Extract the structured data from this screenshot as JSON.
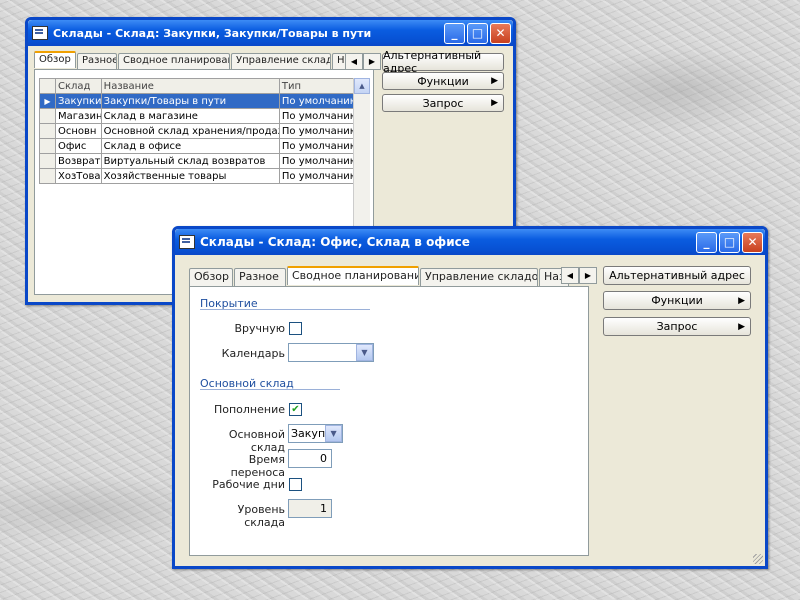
{
  "window1": {
    "title": "Склады - Склад: Закупки, Закупки/Товары в пути",
    "tabs": [
      "Обзор",
      "Разное",
      "Сводное планирование",
      "Управление складом",
      "Наз"
    ],
    "buttons": {
      "alt_address": "Альтернативный адрес",
      "functions": "Функции",
      "request": "Запрос"
    },
    "table": {
      "headers": [
        "Склад",
        "Название",
        "Тип"
      ],
      "rows": [
        [
          "Закупки",
          "Закупки/Товары в пути",
          "По умолчанию"
        ],
        [
          "Магазин",
          "Склад в магазине",
          "По умолчанию"
        ],
        [
          "Основн",
          "Основной склад хранения/продаж",
          "По умолчанию"
        ],
        [
          "Офис",
          "Склад в офисе",
          "По умолчанию"
        ],
        [
          "Возвраты",
          "Виртуальный склад возвратов",
          "По умолчанию"
        ],
        [
          "ХозТовары",
          "Хозяйственные товары",
          "По умолчанию"
        ]
      ]
    }
  },
  "window2": {
    "title": "Склады - Склад: Офис, Склад в офисе",
    "tabs": [
      "Обзор",
      "Разное",
      "Сводное планирование",
      "Управление складом",
      "Наз"
    ],
    "buttons": {
      "alt_address": "Альтернативный адрес",
      "functions": "Функции",
      "request": "Запрос"
    },
    "section_coverage": "Покрытие",
    "manual_label": "Вручную",
    "calendar_label": "Календарь",
    "section_main_warehouse": "Основной склад",
    "replenish_label": "Пополнение",
    "main_warehouse_label": "Основной склад",
    "main_warehouse_value": "Закуп",
    "transfer_time_label": "Время переноса",
    "transfer_time_value": "0",
    "working_days_label": "Рабочие дни",
    "warehouse_level_label": "Уровень склада",
    "warehouse_level_value": "1"
  }
}
